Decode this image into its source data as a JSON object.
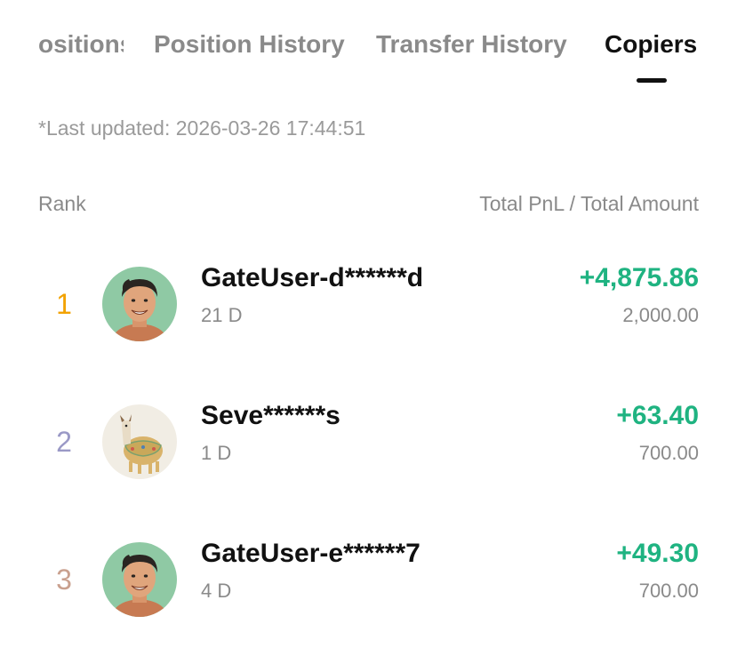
{
  "tabs": [
    {
      "label": "Positions",
      "visible_label": "ositions",
      "active": false
    },
    {
      "label": "Position History",
      "active": false
    },
    {
      "label": "Transfer History",
      "active": false
    },
    {
      "label": "Copiers",
      "active": true
    }
  ],
  "last_updated": "*Last updated: 2026-03-26 17:44:51",
  "columns": {
    "rank": "Rank",
    "pnl_amount": "Total PnL / Total Amount"
  },
  "colors": {
    "rank1": "#f2a200",
    "rank2": "#9a99c6",
    "rank3": "#c9a08e",
    "positive": "#1fb381"
  },
  "copiers": [
    {
      "rank": "1",
      "name": "GateUser-d******d",
      "days": "21 D",
      "pnl": "+4,875.86",
      "amount": "2,000.00",
      "avatar": "man-avatar"
    },
    {
      "rank": "2",
      "name": "Seve******s",
      "days": "1 D",
      "pnl": "+63.40",
      "amount": "700.00",
      "avatar": "llama-avatar"
    },
    {
      "rank": "3",
      "name": "GateUser-e******7",
      "days": "4 D",
      "pnl": "+49.30",
      "amount": "700.00",
      "avatar": "man-avatar"
    }
  ]
}
